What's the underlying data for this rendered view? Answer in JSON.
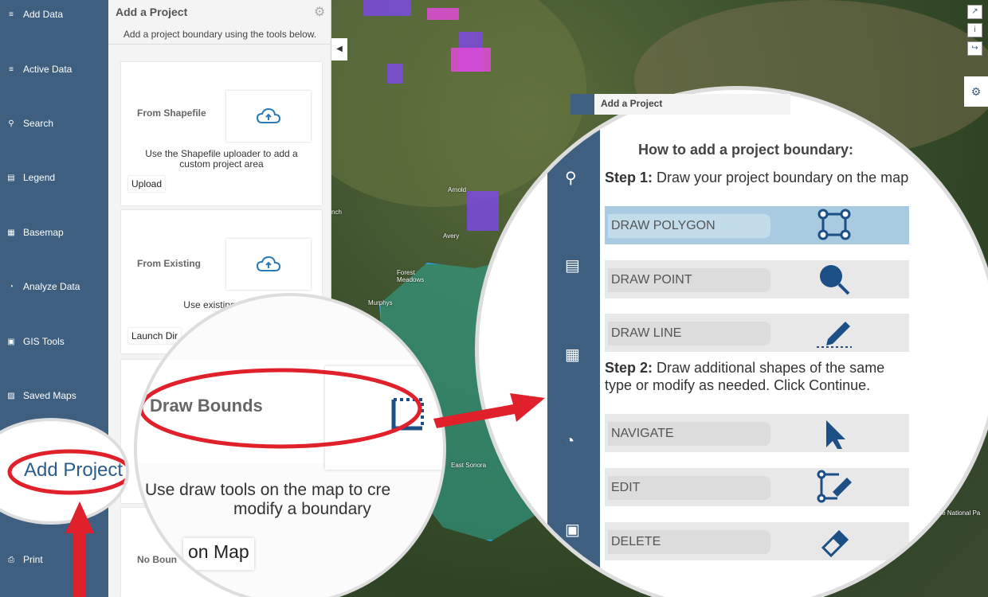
{
  "sidebar": {
    "items": [
      {
        "label": "Add Data",
        "icon": "layers-add-icon"
      },
      {
        "label": "Active Data",
        "icon": "layers-icon"
      },
      {
        "label": "Search",
        "icon": "search-icon"
      },
      {
        "label": "Legend",
        "icon": "map-icon"
      },
      {
        "label": "Basemap",
        "icon": "grid-icon"
      },
      {
        "label": "Analyze Data",
        "icon": "pie-chart-icon"
      },
      {
        "label": "GIS Tools",
        "icon": "toolbox-icon"
      },
      {
        "label": "Saved Maps",
        "icon": "saved-maps-icon"
      },
      {
        "label": "Print",
        "icon": "print-icon"
      }
    ]
  },
  "panel": {
    "title": "Add a Project",
    "subtitle": "Add a project boundary using the tools below.",
    "cards": [
      {
        "title": "From Shapefile",
        "desc1": "Use the Shapefile uploader to add a",
        "desc2": "custom project area",
        "button": "Upload"
      },
      {
        "title": "From Existing",
        "desc1": "Use existing boun",
        "desc2": "",
        "button": "Launch Dir"
      },
      {
        "title": "No Boun",
        "desc1": "",
        "desc2": "",
        "button": ""
      }
    ]
  },
  "lens_left": {
    "card_title": "Draw Bounds",
    "desc1": "Use draw tools on the map to cre",
    "desc2": "modify a boundary",
    "button": "on Map"
  },
  "lens_add": {
    "label": "Add Project"
  },
  "lens_right": {
    "header_title": "Add a Project",
    "heading": "How to add a project boundary:",
    "step1_bold": "Step 1:",
    "step1_text": "Draw your project boundary on the map",
    "step2_bold": "Step 2:",
    "step2_text_1": "Draw additional shapes of the same",
    "step2_text_2": "type or modify as needed. Click Continue.",
    "tools": [
      "DRAW POLYGON",
      "DRAW POINT",
      "DRAW LINE",
      "NAVIGATE",
      "EDIT",
      "DELETE"
    ]
  },
  "map_labels": [
    "Arnold",
    "Avery",
    "Forest Meadows",
    "Murphys",
    "East Sonora",
    "nora",
    "nch",
    "te National Pa"
  ],
  "map_controls": [
    "collapse-icon",
    "info-icon",
    "share-icon"
  ],
  "colors": {
    "sidebar": "#3e5f80",
    "highlight": "#e0202a",
    "boundary": "#30aa96"
  }
}
